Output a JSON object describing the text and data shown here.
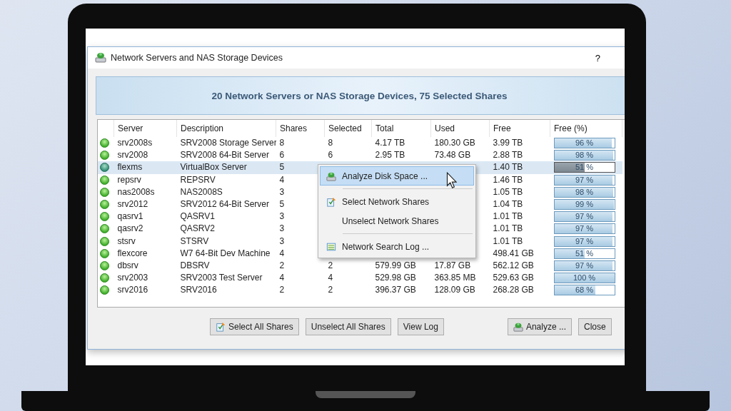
{
  "window": {
    "title": "Network Servers and NAS Storage Devices",
    "help": "?"
  },
  "banner": "20 Network Servers or NAS Storage Devices, 75 Selected Shares",
  "table": {
    "columns": [
      "Server",
      "Description",
      "Shares",
      "Selected",
      "Total",
      "Used",
      "Free",
      "Free (%)"
    ],
    "rows": [
      {
        "server": "srv2008s",
        "description": "SRV2008 Storage Server",
        "shares": "8",
        "selected_count": "8",
        "total": "4.17 TB",
        "used": "180.30 GB",
        "free": "3.99 TB",
        "free_pct": "96 %",
        "level": 0.96,
        "selected": false
      },
      {
        "server": "srv2008",
        "description": "SRV2008 64-Bit Server",
        "shares": "6",
        "selected_count": "6",
        "total": "2.95 TB",
        "used": "73.48 GB",
        "free": "2.88 TB",
        "free_pct": "98 %",
        "level": 0.98,
        "selected": false
      },
      {
        "server": "flexms",
        "description": "VirtualBox Server",
        "shares": "5",
        "free": "1.40 TB",
        "free_pct": "51 %",
        "level": 0.51,
        "selected": true
      },
      {
        "server": "repsrv",
        "description": "REPSRV",
        "shares": "4",
        "free": "1.46 TB",
        "free_pct": "97 %",
        "level": 0.97,
        "selected": false
      },
      {
        "server": "nas2008s",
        "description": "NAS2008S",
        "shares": "3",
        "free": "1.05 TB",
        "free_pct": "98 %",
        "level": 0.98,
        "selected": false
      },
      {
        "server": "srv2012",
        "description": "SRV2012 64-Bit Server",
        "shares": "5",
        "free": "1.04 TB",
        "free_pct": "99 %",
        "level": 0.99,
        "selected": false
      },
      {
        "server": "qasrv1",
        "description": "QASRV1",
        "shares": "3",
        "free": "1.01 TB",
        "free_pct": "97 %",
        "level": 0.97,
        "selected": false
      },
      {
        "server": "qasrv2",
        "description": "QASRV2",
        "shares": "3",
        "free": "1.01 TB",
        "free_pct": "97 %",
        "level": 0.97,
        "selected": false
      },
      {
        "server": "stsrv",
        "description": "STSRV",
        "shares": "3",
        "free": "1.01 TB",
        "free_pct": "97 %",
        "level": 0.97,
        "selected": false
      },
      {
        "server": "flexcore",
        "description": "W7 64-Bit Dev Machine",
        "shares": "4",
        "free": "498.41 GB",
        "free_pct": "51 %",
        "level": 0.51,
        "selected": false
      },
      {
        "server": "dbsrv",
        "description": "DBSRV",
        "shares": "2",
        "selected_count": "2",
        "total": "579.99 GB",
        "used": "17.87 GB",
        "free": "562.12 GB",
        "free_pct": "97 %",
        "level": 0.97,
        "selected": false
      },
      {
        "server": "srv2003",
        "description": "SRV2003 Test Server",
        "shares": "4",
        "selected_count": "4",
        "total": "529.98 GB",
        "used": "363.85 MB",
        "free": "529.63 GB",
        "free_pct": "100 %",
        "level": 1.0,
        "selected": false
      },
      {
        "server": "srv2016",
        "description": "SRV2016",
        "shares": "2",
        "selected_count": "2",
        "total": "396.37 GB",
        "used": "128.09 GB",
        "free": "268.28 GB",
        "free_pct": "68 %",
        "level": 0.68,
        "selected": false
      }
    ]
  },
  "context_menu": [
    {
      "kind": "item",
      "label": "Analyze Disk Space ...",
      "selected": true
    },
    {
      "kind": "separator"
    },
    {
      "kind": "item",
      "label": "Select Network Shares",
      "selected": false
    },
    {
      "kind": "item",
      "label": "Unselect Network Shares",
      "selected": false
    },
    {
      "kind": "separator"
    },
    {
      "kind": "item",
      "label": "Network Search Log ...",
      "selected": false
    }
  ],
  "buttons": [
    "Select All Shares",
    "Unselect All Shares",
    "View Log",
    "Analyze ...",
    "Close"
  ]
}
